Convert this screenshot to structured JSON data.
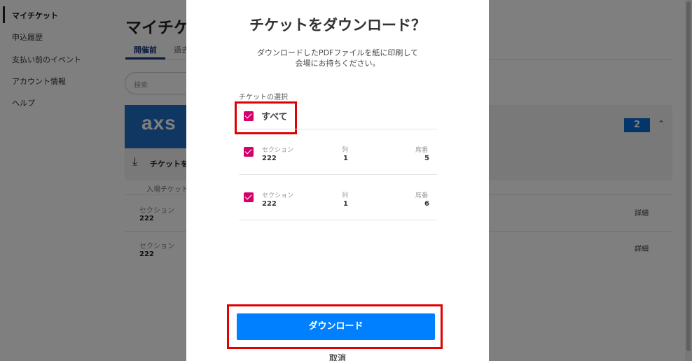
{
  "sidebar": {
    "items": [
      {
        "label": "マイチケット"
      },
      {
        "label": "申込履歴"
      },
      {
        "label": "支払い前のイベント"
      },
      {
        "label": "アカウント情報"
      },
      {
        "label": "ヘルプ"
      }
    ]
  },
  "page": {
    "title": "マイチケ",
    "tabs": [
      {
        "label": "開催前"
      },
      {
        "label": "過去"
      }
    ],
    "search_placeholder": "検索",
    "event_logo": "axs",
    "ticket_count": "2",
    "download_row_text": "チケットを",
    "entry_text": "入場チケット",
    "rows": [
      {
        "label": "セクション",
        "value": "222",
        "detail": "詳細"
      },
      {
        "label": "セクション",
        "value": "222",
        "detail": "詳細"
      }
    ]
  },
  "modal": {
    "title": "チケットをダウンロード？",
    "description": "ダウンロードしたPDFファイルを紙に印刷して会場にお持ちください。",
    "select_label": "チケットの選択",
    "all_label": "すべて",
    "column_labels": {
      "section": "セクション",
      "row": "列",
      "seat": "席番"
    },
    "tickets": [
      {
        "section": "222",
        "row": "1",
        "seat": "5"
      },
      {
        "section": "222",
        "row": "1",
        "seat": "6"
      }
    ],
    "download_button": "ダウンロード",
    "cancel": "取消"
  },
  "colors": {
    "checkbox": "#d6006b",
    "primary_button": "#0080ff",
    "highlight": "#e00000",
    "brand": "#1e6fc4"
  }
}
